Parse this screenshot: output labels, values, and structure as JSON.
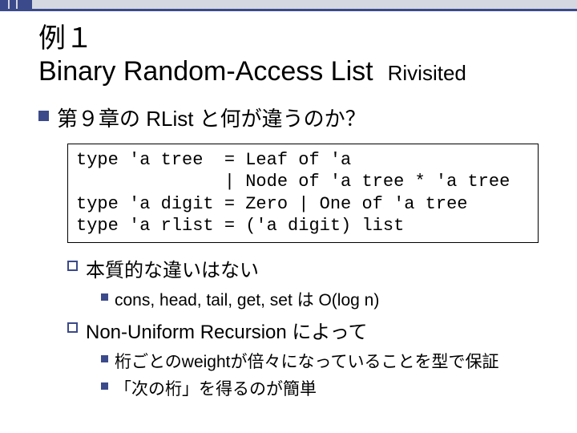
{
  "title": {
    "line1": "例１",
    "line2_main": "Binary Random-Access List",
    "line2_sub": "Rivisited"
  },
  "bullet1": "第９章の RList と何が違うのか？",
  "code": "type 'a tree  = Leaf of 'a\n              | Node of 'a tree * 'a tree\ntype 'a digit = Zero | One of 'a tree\ntype 'a rlist = ('a digit) list",
  "sub1": {
    "heading": "本質的な違いはない",
    "items": [
      "cons, head, tail, get, set は O(log n)"
    ]
  },
  "sub2": {
    "heading": "Non-Uniform Recursion によって",
    "items": [
      "桁ごとのweightが倍々になっていることを型で保証",
      "「次の桁」を得るのが簡単"
    ]
  }
}
